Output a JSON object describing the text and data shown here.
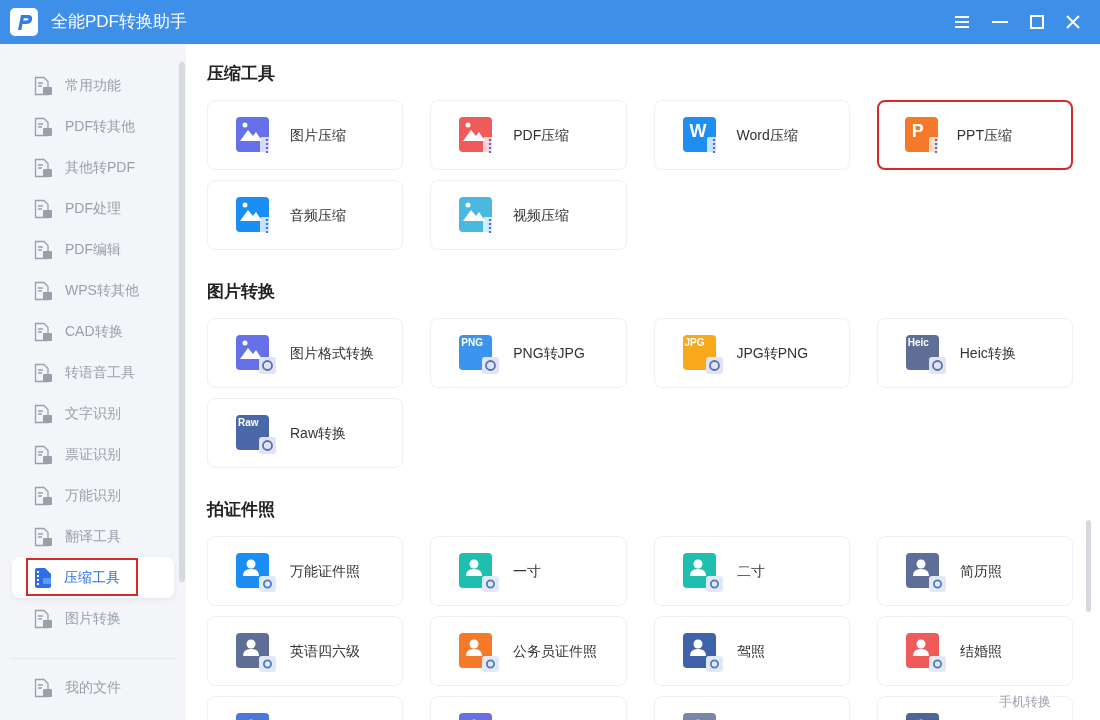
{
  "window": {
    "title": "全能PDF转换助手"
  },
  "sidebar": {
    "items": [
      {
        "label": "常用功能",
        "selected": false,
        "highlighted": false
      },
      {
        "label": "PDF转其他",
        "selected": false,
        "highlighted": false
      },
      {
        "label": "其他转PDF",
        "selected": false,
        "highlighted": false
      },
      {
        "label": "PDF处理",
        "selected": false,
        "highlighted": false
      },
      {
        "label": "PDF编辑",
        "selected": false,
        "highlighted": false
      },
      {
        "label": "WPS转其他",
        "selected": false,
        "highlighted": false
      },
      {
        "label": "CAD转换",
        "selected": false,
        "highlighted": false
      },
      {
        "label": "转语音工具",
        "selected": false,
        "highlighted": false
      },
      {
        "label": "文字识别",
        "selected": false,
        "highlighted": false
      },
      {
        "label": "票证识别",
        "selected": false,
        "highlighted": false
      },
      {
        "label": "万能识别",
        "selected": false,
        "highlighted": false
      },
      {
        "label": "翻译工具",
        "selected": false,
        "highlighted": false
      },
      {
        "label": "压缩工具",
        "selected": true,
        "highlighted": true
      },
      {
        "label": "图片转换",
        "selected": false,
        "highlighted": false
      }
    ],
    "footer_item": "我的文件"
  },
  "sections": [
    {
      "title": "压缩工具",
      "cards": [
        {
          "label": "图片压缩",
          "kind": "compress",
          "color": "#6670e8",
          "highlighted": false
        },
        {
          "label": "PDF压缩",
          "kind": "compress",
          "color": "#ef5a5a",
          "highlighted": false
        },
        {
          "label": "Word压缩",
          "kind": "compress",
          "color": "#1e8ef0",
          "icon_text": "W",
          "highlighted": false
        },
        {
          "label": "PPT压缩",
          "kind": "compress",
          "color": "#f47a2a",
          "icon_text": "P",
          "highlighted": true
        },
        {
          "label": "音频压缩",
          "kind": "compress",
          "color": "#1a8ef5",
          "highlighted": false
        },
        {
          "label": "视频压缩",
          "kind": "compress",
          "color": "#4ab8e0",
          "highlighted": false
        }
      ]
    },
    {
      "title": "图片转换",
      "cards": [
        {
          "label": "图片格式转换",
          "kind": "convert",
          "color": "#6670e8",
          "highlighted": false
        },
        {
          "label": "PNG转JPG",
          "kind": "convert",
          "color": "#3b95f0",
          "icon_text": "PNG",
          "highlighted": false
        },
        {
          "label": "JPG转PNG",
          "kind": "convert",
          "color": "#f7a81b",
          "icon_text": "JPG",
          "highlighted": false
        },
        {
          "label": "Heic转换",
          "kind": "convert",
          "color": "#5f6e96",
          "icon_text": "Heic",
          "highlighted": false
        },
        {
          "label": "Raw转换",
          "kind": "convert",
          "color": "#4a68a8",
          "icon_text": "Raw",
          "highlighted": false
        }
      ]
    },
    {
      "title": "拍证件照",
      "cards": [
        {
          "label": "万能证件照",
          "kind": "photo",
          "color": "#1a8ef5",
          "highlighted": false
        },
        {
          "label": "一寸",
          "kind": "photo",
          "color": "#1fbfb0",
          "highlighted": false
        },
        {
          "label": "二寸",
          "kind": "photo",
          "color": "#1fbfb0",
          "highlighted": false
        },
        {
          "label": "简历照",
          "kind": "photo",
          "color": "#5f6e96",
          "highlighted": false
        },
        {
          "label": "英语四六级",
          "kind": "photo",
          "color": "#5f6e96",
          "highlighted": false
        },
        {
          "label": "公务员证件照",
          "kind": "photo",
          "color": "#f47a2a",
          "highlighted": false
        },
        {
          "label": "驾照",
          "kind": "photo",
          "color": "#3f63a8",
          "highlighted": false
        },
        {
          "label": "结婚照",
          "kind": "photo",
          "color": "#ef5a5a",
          "highlighted": false
        },
        {
          "kind": "photo",
          "color": "#4a78d6",
          "highlighted": false
        },
        {
          "kind": "photo",
          "color": "#6a6fe0",
          "highlighted": false
        },
        {
          "kind": "photo",
          "color": "#7a86a8",
          "highlighted": false
        },
        {
          "kind": "photo",
          "color": "#4f6597",
          "highlighted": false
        }
      ]
    }
  ],
  "floating_link": "手机转换"
}
